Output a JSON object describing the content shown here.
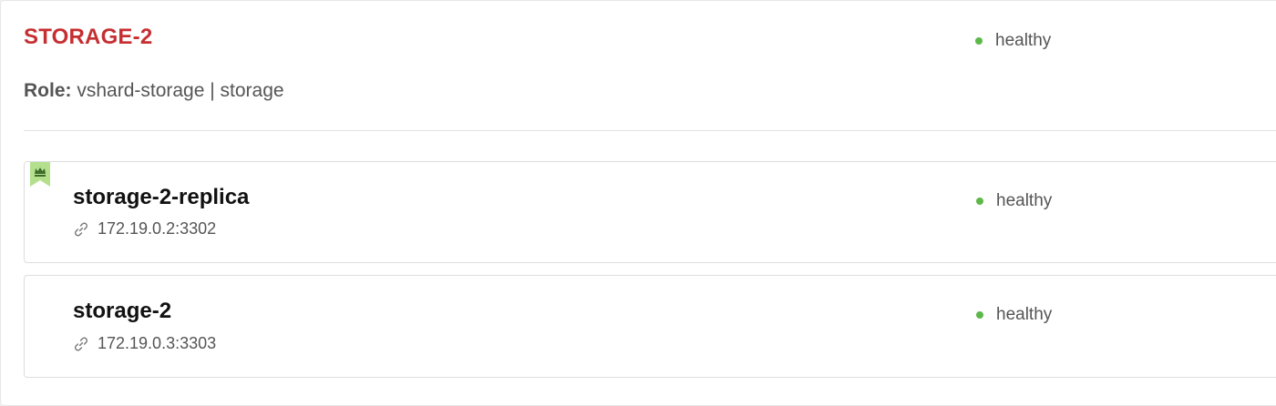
{
  "replicaset": {
    "name": "STORAGE-2",
    "status": "healthy",
    "role_label": "Role:",
    "role_value": "vshard-storage | storage"
  },
  "servers": [
    {
      "alias": "storage-2-replica",
      "uri": "172.19.0.2:3302",
      "status": "healthy",
      "leader": true
    },
    {
      "alias": "storage-2",
      "uri": "172.19.0.3:3303",
      "status": "healthy",
      "leader": false
    }
  ],
  "colors": {
    "replicaset_name": "#c62f32",
    "healthy_dot": "#5cb848",
    "leader_flag": "#b4e08e"
  },
  "icons": {
    "leader": "crown-icon",
    "uri": "link-icon",
    "status": "status-dot-icon"
  }
}
